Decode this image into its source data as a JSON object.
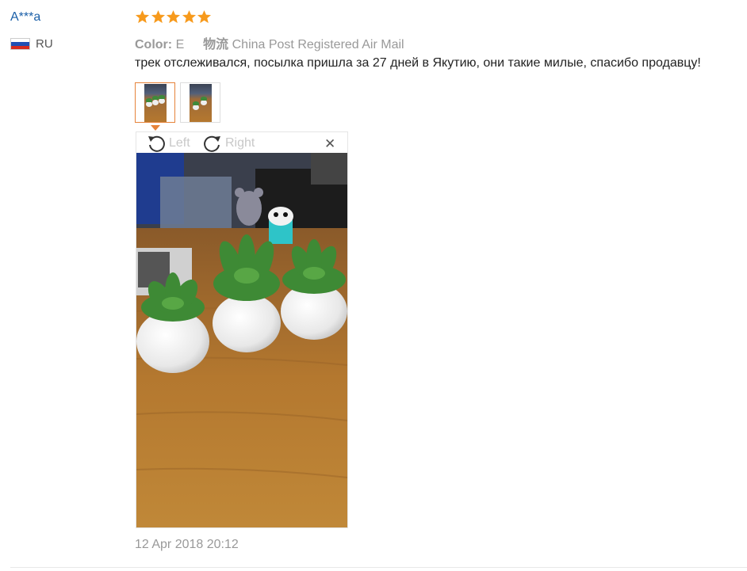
{
  "reviewer": {
    "name": "A***a",
    "country_code": "RU",
    "flag_colors": [
      "#ffffff",
      "#1f4fb4",
      "#d52b1e"
    ]
  },
  "rating": {
    "stars": 5,
    "max": 5,
    "color": "#f79a1c"
  },
  "attributes": {
    "color_label": "Color:",
    "color_value": "E",
    "shipping_label": "物流",
    "shipping_value": "China Post Registered Air Mail"
  },
  "review_text": "трек отслеживался, посылка пришла за 27 дней в Якутию, они такие милые, спасибо продавцу!",
  "thumbnails": [
    {
      "icon": "photo-thumbnail",
      "active": true
    },
    {
      "icon": "photo-thumbnail",
      "active": false
    }
  ],
  "viewer": {
    "rotate_left_label": "Left",
    "rotate_right_label": "Right",
    "close_icon": "close-icon"
  },
  "date": "12 Apr 2018 20:12",
  "accent_color": "#e6833a"
}
